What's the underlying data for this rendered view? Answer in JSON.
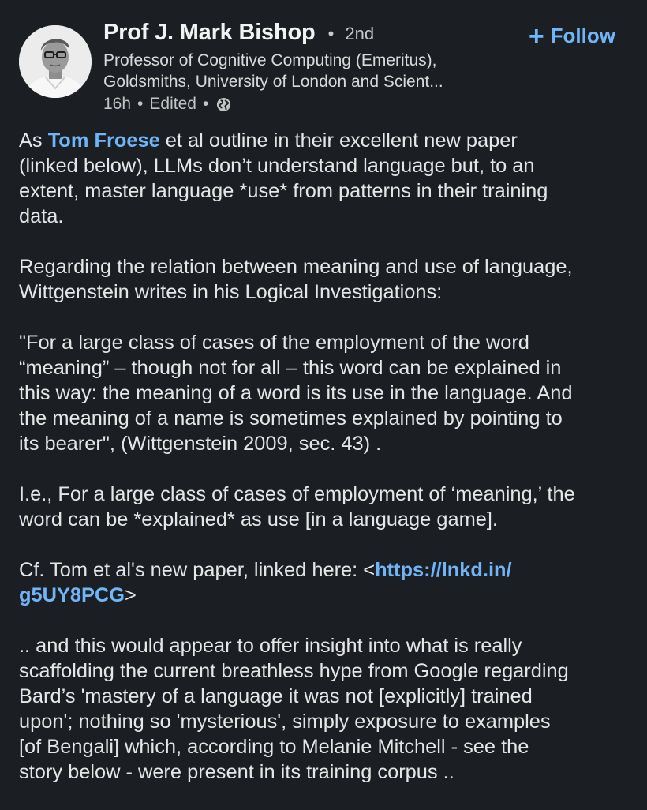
{
  "author": {
    "name": "Prof J. Mark Bishop",
    "separator": "•",
    "degree": "2nd",
    "headline_line1": "Professor of Cognitive Computing (Emeritus),",
    "headline_line2": "Goldsmiths, University of London and Scient..."
  },
  "meta": {
    "time": "16h",
    "edited": "Edited",
    "dot": "•",
    "visibility_icon": "globe-icon"
  },
  "follow": {
    "plus": "+",
    "label": "Follow"
  },
  "post": {
    "p1_l1_pre": "As ",
    "p1_mention": "Tom Froese",
    "p1_l1_post": " et al outline in their excellent new paper",
    "p1_l2": "(linked below), LLMs don’t understand language but, to an",
    "p1_l3": "extent, master language *use* from patterns in their training",
    "p1_l4": "data.",
    "p2_l1": "Regarding the relation between meaning and use of language,",
    "p2_l2": "Wittgenstein writes in his Logical Investigations:",
    "p3_l1": "\"For a large class of cases of the employment of the word",
    "p3_l2": "“meaning” – though not for all – this word can be explained in",
    "p3_l3": "this way: the meaning of a word is its use in the language. And",
    "p3_l4": "the meaning of a name is sometimes explained by pointing to",
    "p3_l5": "its bearer\", (Wittgenstein 2009, sec. 43) .",
    "p4_l1": "I.e., For a large class of cases of employment of ‘meaning,’ the",
    "p4_l2": "word can be *explained* as use [in a language game].",
    "p5_l1_pre": "Cf. Tom et al's new paper, linked here: <",
    "p5_link_part1": "https://lnkd.in/",
    "p5_link_part2": "g5UY8PCG",
    "p5_l2_post": ">",
    "p6_l1": ".. and this would appear to offer insight into what is really",
    "p6_l2": "scaffolding the current breathless hype from Google regarding",
    "p6_l3": "Bard’s 'mastery of a language it was not [explicitly] trained",
    "p6_l4": "upon'; nothing so 'mysterious', simply exposure to examples",
    "p6_l5": "[of Bengali] which, according to Melanie Mitchell - see the",
    "p6_l6": "story below - were present in its training corpus .."
  },
  "colors": {
    "background": "#1b1f23",
    "link": "#70b5f9",
    "text": "#e6e6e6"
  }
}
